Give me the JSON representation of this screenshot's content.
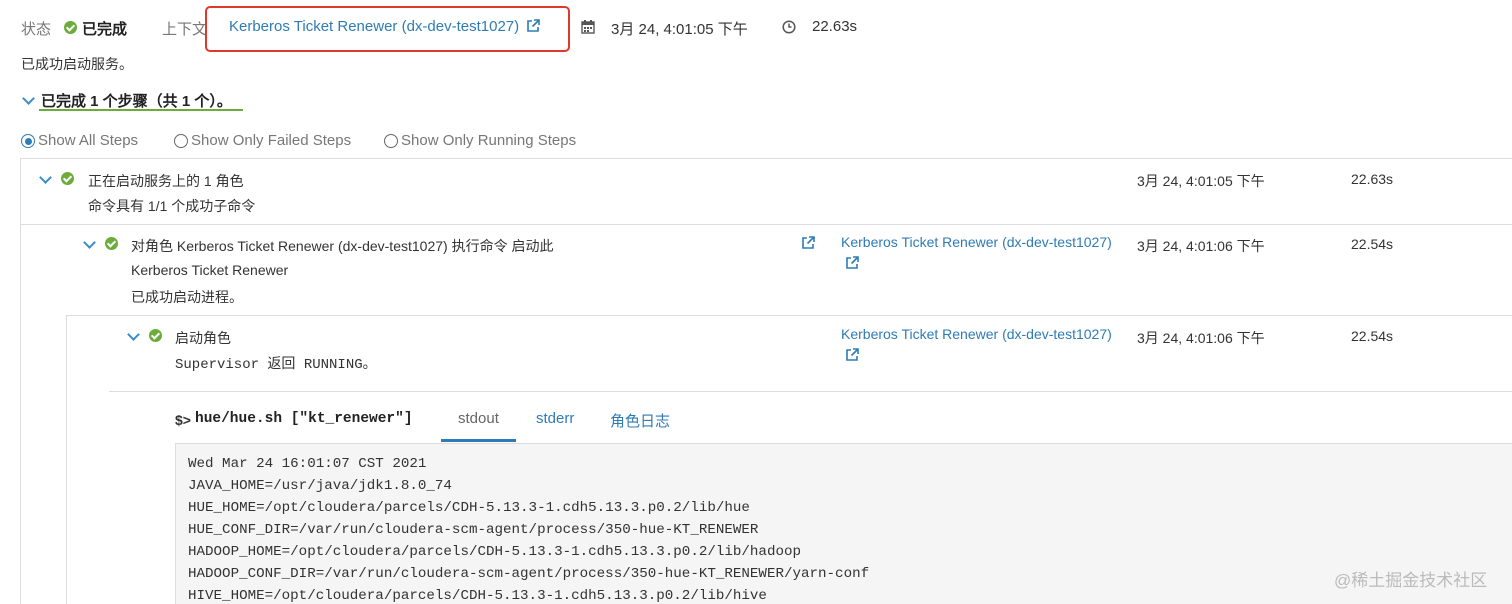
{
  "header": {
    "status_label": "状态",
    "status_value": "已完成",
    "context_label": "上下文",
    "context_link": "Kerberos Ticket Renewer (dx-dev-test1027)",
    "datetime": "3月 24, 4:01:05 下午",
    "duration": "22.63s",
    "message": "已成功启动服务。"
  },
  "steps_summary": "已完成 1 个步骤（共 1 个）。",
  "filters": {
    "all": "Show All Steps",
    "failed": "Show Only Failed Steps",
    "running": "Show Only Running Steps",
    "selected": "all"
  },
  "rows": [
    {
      "title": "正在启动服务上的 1 角色",
      "subtitle": "命令具有  1/1  个成功子命令",
      "datetime": "3月 24, 4:01:05 下午",
      "duration": "22.63s"
    },
    {
      "title": "对角色 Kerberos Ticket Renewer (dx-dev-test1027) 执行命令 启动此",
      "title2": "Kerberos Ticket Renewer",
      "subtitle": "已成功启动进程。",
      "context_link": "Kerberos Ticket Renewer (dx-dev-test1027)",
      "datetime": "3月 24, 4:01:06 下午",
      "duration": "22.54s"
    },
    {
      "title": "启动角色",
      "subtitle": "Supervisor 返回 RUNNING。",
      "context_link": "Kerberos Ticket Renewer (dx-dev-test1027)",
      "datetime": "3月 24, 4:01:06 下午",
      "duration": "22.54s"
    }
  ],
  "command": {
    "prompt": "$>",
    "text": "hue/hue.sh [\"kt_renewer\"]"
  },
  "tabs": [
    "stdout",
    "stderr",
    "角色日志"
  ],
  "active_tab": "stdout",
  "stdout_lines": [
    "Wed Mar 24 16:01:07 CST 2021",
    "JAVA_HOME=/usr/java/jdk1.8.0_74",
    "HUE_HOME=/opt/cloudera/parcels/CDH-5.13.3-1.cdh5.13.3.p0.2/lib/hue",
    "HUE_CONF_DIR=/var/run/cloudera-scm-agent/process/350-hue-KT_RENEWER",
    "HADOOP_HOME=/opt/cloudera/parcels/CDH-5.13.3-1.cdh5.13.3.p0.2/lib/hadoop",
    "HADOOP_CONF_DIR=/var/run/cloudera-scm-agent/process/350-hue-KT_RENEWER/yarn-conf",
    "HIVE_HOME=/opt/cloudera/parcels/CDH-5.13.3-1.cdh5.13.3.p0.2/lib/hive"
  ],
  "watermark": "@稀土掘金技术社区",
  "colors": {
    "link": "#2f7bb5",
    "success": "#6cac3a",
    "highlight": "#e0392b",
    "summary_underline": "#6cac3a"
  }
}
